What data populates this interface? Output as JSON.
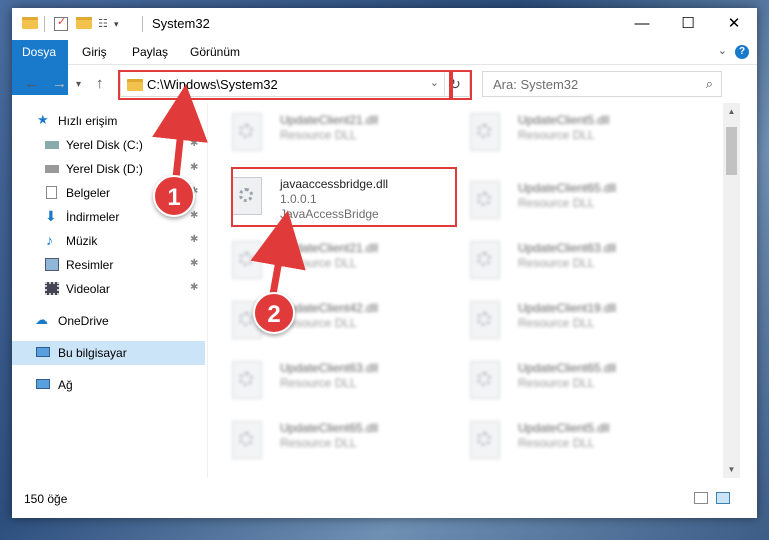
{
  "window": {
    "title": "System32",
    "minimize": "—",
    "maximize": "☐",
    "close": "✕"
  },
  "ribbon": {
    "tabs": [
      "Dosya",
      "Giriş",
      "Paylaş",
      "Görünüm"
    ],
    "help": "?"
  },
  "address": {
    "path": "C:\\Windows\\System32",
    "search_placeholder": "Ara: System32"
  },
  "sidebar": {
    "items": [
      {
        "label": "Hızlı erişim"
      },
      {
        "label": "Yerel Disk (C:)"
      },
      {
        "label": "Yerel Disk (D:)"
      },
      {
        "label": "Belgeler"
      },
      {
        "label": "İndirmeler"
      },
      {
        "label": "Müzik"
      },
      {
        "label": "Resimler"
      },
      {
        "label": "Videolar"
      },
      {
        "label": "OneDrive"
      },
      {
        "label": "Bu bilgisayar"
      },
      {
        "label": "Ağ"
      }
    ]
  },
  "files": {
    "highlight": {
      "name": "javaaccessbridge.dll",
      "version": "1.0.0.1",
      "description": "JavaAccessBridge"
    },
    "left": [
      {
        "name": "UpdateClient21.dll",
        "type": "Resource DLL"
      },
      {
        "name": "UpdateClient21.dll",
        "type": "Resource DLL"
      },
      {
        "name": "UpdateClient42.dll",
        "type": "Resource DLL"
      },
      {
        "name": "UpdateClient63.dll",
        "type": "Resource DLL"
      },
      {
        "name": "UpdateClient65.dll",
        "type": "Resource DLL"
      }
    ],
    "right": [
      {
        "name": "UpdateClient5.dll",
        "type": "Resource DLL"
      },
      {
        "name": "UpdateClient65.dll",
        "type": "Resource DLL"
      },
      {
        "name": "UpdateClient63.dll",
        "type": "Resource DLL"
      },
      {
        "name": "UpdateClient19.dll",
        "type": "Resource DLL"
      },
      {
        "name": "UpdateClient65.dll",
        "type": "Resource DLL"
      },
      {
        "name": "UpdateClient5.dll",
        "type": "Resource DLL"
      }
    ]
  },
  "status": {
    "count": "150 öğe"
  },
  "annotations": {
    "step1": "1",
    "step2": "2",
    "color": "#e03a3a"
  }
}
